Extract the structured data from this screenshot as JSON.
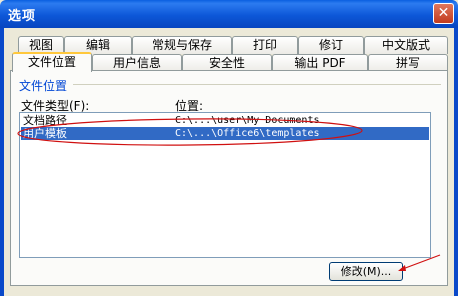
{
  "window": {
    "title": "选项",
    "close_glyph": "✕"
  },
  "tabs_row1": [
    "视图",
    "编辑",
    "常规与保存",
    "打印",
    "修订",
    "中文版式"
  ],
  "tabs_row2": [
    "文件位置",
    "用户信息",
    "安全性",
    "输出 PDF",
    "拼写"
  ],
  "active_tab": "文件位置",
  "group": {
    "title": "文件位置",
    "col_type": "文件类型(F):",
    "col_location": "位置:"
  },
  "rows": [
    {
      "type": "文档路径",
      "location": "C:\\...\\user\\My Documents",
      "selected": false
    },
    {
      "type": "用户模板",
      "location": "C:\\...\\Office6\\templates",
      "selected": true
    }
  ],
  "buttons": {
    "modify": "修改(M)..."
  },
  "colors": {
    "annotation": "#D01010",
    "selection": "#316AC5",
    "titlebar": "#0A5FE0"
  }
}
